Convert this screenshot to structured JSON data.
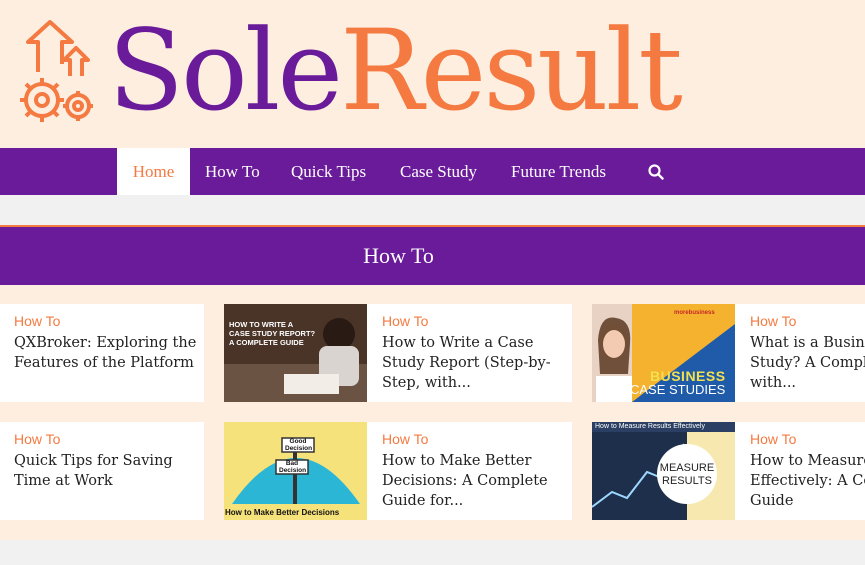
{
  "brand": {
    "part1": "Sole",
    "part2": "Result"
  },
  "nav": {
    "items": [
      {
        "label": "Home",
        "active": true
      },
      {
        "label": "How To"
      },
      {
        "label": "Quick Tips"
      },
      {
        "label": "Case Study"
      },
      {
        "label": "Future Trends"
      }
    ],
    "search_icon": "search-icon"
  },
  "section": {
    "title": "How To"
  },
  "colors": {
    "purple": "#6a1b9a",
    "orange": "#f47a41",
    "cream": "#fdeee0"
  },
  "cards": [
    {
      "category": "How To",
      "title_lines": [
        "QXBroker: Exploring the",
        "Features of the Platform"
      ]
    },
    {
      "category": "How To",
      "title_lines": [
        "How to Write a Case",
        "Study Report (Step-by-",
        "Step, with..."
      ],
      "thumb_text": [
        "HOW TO WRITE A",
        "CASE STUDY REPORT?",
        "A COMPLETE GUIDE"
      ]
    },
    {
      "category": "How To",
      "title_lines": [
        "What is a Busine",
        "Study? A Comple",
        "with..."
      ],
      "thumb_text": [
        "BUSINESS",
        "CASE STUDIES"
      ],
      "thumb_logo": "morebusiness"
    },
    {
      "category": "How To",
      "title_lines": [
        "Quick Tips for Saving",
        "Time at Work"
      ]
    },
    {
      "category": "How To",
      "title_lines": [
        "How to Make Better",
        "Decisions: A Complete",
        "Guide for..."
      ],
      "thumb_text": [
        "Good",
        "Decision",
        "Bad",
        "Decision",
        "How to Make Better Decisions"
      ]
    },
    {
      "category": "How To",
      "title_lines": [
        "How to Measure",
        "Effectively: A Co",
        "Guide"
      ],
      "thumb_text": [
        "How to Measure Results Effectively",
        "MEASURE",
        "RESULTS"
      ]
    }
  ]
}
